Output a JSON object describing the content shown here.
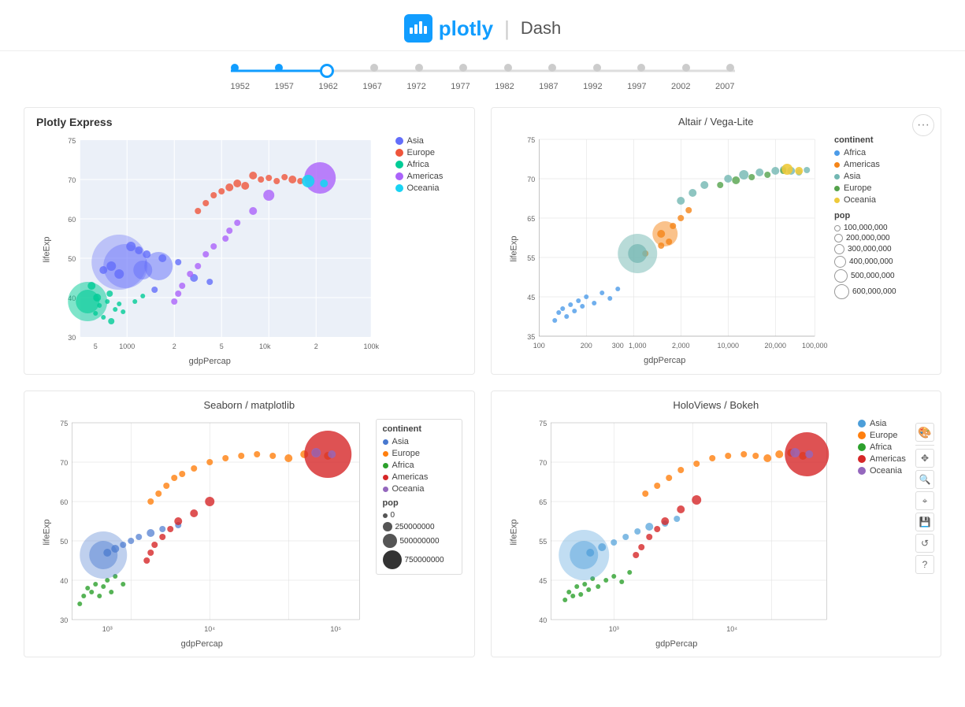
{
  "header": {
    "logo_text": "plotly",
    "logo_dash": "Dash"
  },
  "slider": {
    "years": [
      "1952",
      "1957",
      "1962",
      "1967",
      "1972",
      "1977",
      "1982",
      "1987",
      "1992",
      "1997",
      "2002",
      "2007"
    ],
    "active_index": 2
  },
  "charts": {
    "plotly_express": {
      "title": "Plotly Express",
      "x_label": "gdpPercap",
      "y_label": "lifeExp",
      "legend": {
        "items": [
          {
            "label": "Asia",
            "color": "#636EFA"
          },
          {
            "label": "Europe",
            "color": "#EF553B"
          },
          {
            "label": "Africa",
            "color": "#00CC96"
          },
          {
            "label": "Americas",
            "color": "#AB63FA"
          },
          {
            "label": "Oceania",
            "color": "#19D3F3"
          }
        ]
      }
    },
    "altair": {
      "title": "Altair / Vega-Lite",
      "x_label": "gdpPercap",
      "y_label": "lifeExp",
      "legend": {
        "continent_title": "continent",
        "continent_items": [
          {
            "label": "Africa",
            "color": "#4C9BE8"
          },
          {
            "label": "Americas",
            "color": "#F58518"
          },
          {
            "label": "Asia",
            "color": "#72B7B2"
          },
          {
            "label": "Europe",
            "color": "#54A24B"
          },
          {
            "label": "Oceania",
            "color": "#EECA3B"
          }
        ],
        "pop_title": "pop",
        "pop_items": [
          {
            "label": "100,000,000",
            "size": 8
          },
          {
            "label": "200,000,000",
            "size": 11
          },
          {
            "label": "300,000,000",
            "size": 13
          },
          {
            "label": "400,000,000",
            "size": 15
          },
          {
            "label": "500,000,000",
            "size": 17
          },
          {
            "label": "600,000,000",
            "size": 19
          }
        ]
      }
    },
    "seaborn": {
      "title": "Seaborn / matplotlib",
      "x_label": "gdpPercap",
      "y_label": "lifeExp",
      "legend": {
        "continent_title": "continent",
        "continent_items": [
          {
            "label": "Asia",
            "color": "#4878CF"
          },
          {
            "label": "Europe",
            "color": "#FF7F0E"
          },
          {
            "label": "Africa",
            "color": "#2CA02C"
          },
          {
            "label": "Americas",
            "color": "#D62728"
          },
          {
            "label": "Oceania",
            "color": "#9467BD"
          }
        ],
        "pop_title": "pop",
        "pop_items": [
          {
            "label": "0",
            "size": 6
          },
          {
            "label": "250000000",
            "size": 14
          },
          {
            "label": "500000000",
            "size": 20
          },
          {
            "label": "750000000",
            "size": 26
          }
        ]
      }
    },
    "holoviews": {
      "title": "HoloViews / Bokeh",
      "x_label": "gdpPercap",
      "y_label": "lifeExp",
      "legend": {
        "items": [
          {
            "label": "Asia",
            "color": "#4C9ED9"
          },
          {
            "label": "Europe",
            "color": "#FF7F0E"
          },
          {
            "label": "Africa",
            "color": "#2CA02C"
          },
          {
            "label": "Americas",
            "color": "#D62728"
          },
          {
            "label": "Oceania",
            "color": "#9467BD"
          }
        ]
      }
    }
  }
}
